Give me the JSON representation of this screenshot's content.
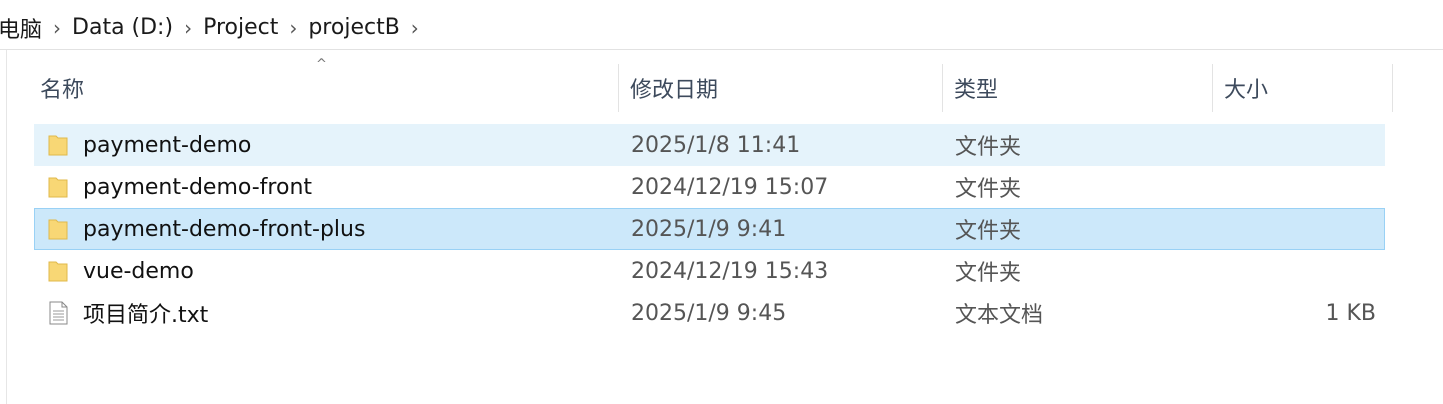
{
  "breadcrumb": {
    "items": [
      "电脑",
      "Data (D:)",
      "Project",
      "projectB"
    ]
  },
  "columns": {
    "name": "名称",
    "date": "修改日期",
    "type": "类型",
    "size": "大小"
  },
  "files": [
    {
      "name": "payment-demo",
      "date": "2025/1/8 11:41",
      "type": "文件夹",
      "size": "",
      "icon": "folder-icon",
      "state": "hover"
    },
    {
      "name": "payment-demo-front",
      "date": "2024/12/19 15:07",
      "type": "文件夹",
      "size": "",
      "icon": "folder-icon",
      "state": ""
    },
    {
      "name": "payment-demo-front-plus",
      "date": "2025/1/9 9:41",
      "type": "文件夹",
      "size": "",
      "icon": "folder-icon",
      "state": "selected"
    },
    {
      "name": "vue-demo",
      "date": "2024/12/19 15:43",
      "type": "文件夹",
      "size": "",
      "icon": "folder-icon",
      "state": ""
    },
    {
      "name": "项目简介.txt",
      "date": "2025/1/9 9:45",
      "type": "文本文档",
      "size": "1 KB",
      "icon": "text-file-icon",
      "state": ""
    }
  ],
  "colors": {
    "hover_bg": "#e5f3fb",
    "selected_bg": "#cce8fa",
    "selected_border": "#99d1f5",
    "folder": "#f8d775"
  }
}
